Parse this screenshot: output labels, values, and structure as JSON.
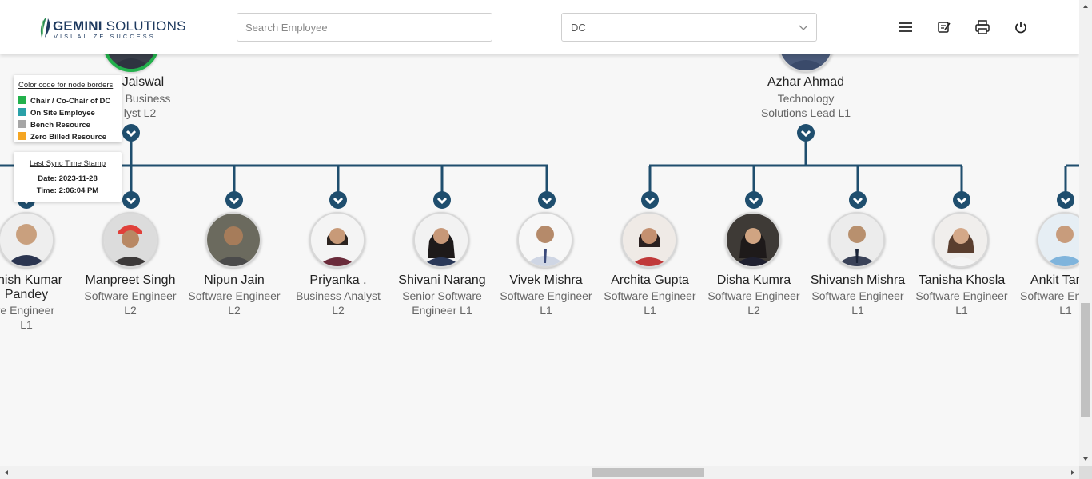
{
  "header": {
    "logo_name_bold": "GEMINI",
    "logo_name_rest": " SOLUTIONS",
    "logo_tagline": "VISUALIZE SUCCESS",
    "search_placeholder": "Search Employee",
    "dept_select_value": "DC"
  },
  "toolbar_icons": [
    "menu-icon",
    "notes-icon",
    "print-icon",
    "power-icon"
  ],
  "top_managers": [
    {
      "name": "i Jaiswal",
      "designation_line1": "Business",
      "designation_line2": "lyst L2"
    },
    {
      "name": "Azhar Ahmad",
      "designation_line1": "Technology",
      "designation_line2": "Solutions Lead L1"
    }
  ],
  "employees": [
    {
      "name_line1": "anish Kumar",
      "name_line2": "Pandey",
      "designation_line1": "ware Engineer",
      "designation_line2": "L1"
    },
    {
      "name_line1": "Manpreet Singh",
      "designation_line1": "Software Engineer",
      "designation_line2": "L2"
    },
    {
      "name_line1": "Nipun Jain",
      "designation_line1": "Software Engineer",
      "designation_line2": "L2"
    },
    {
      "name_line1": "Priyanka .",
      "designation_line1": "Business Analyst",
      "designation_line2": "L2"
    },
    {
      "name_line1": "Shivani Narang",
      "designation_line1": "Senior Software",
      "designation_line2": "Engineer L1"
    },
    {
      "name_line1": "Vivek Mishra",
      "designation_line1": "Software Engineer",
      "designation_line2": "L1"
    },
    {
      "name_line1": "Archita Gupta",
      "designation_line1": "Software Engineer",
      "designation_line2": "L1"
    },
    {
      "name_line1": "Disha Kumra",
      "designation_line1": "Software Engineer",
      "designation_line2": "L2"
    },
    {
      "name_line1": "Shivansh Mishra",
      "designation_line1": "Software Engineer",
      "designation_line2": "L1"
    },
    {
      "name_line1": "Tanisha Khosla",
      "designation_line1": "Software Engineer",
      "designation_line2": "L1"
    },
    {
      "name_line1": "Ankit Tan",
      "designation_line1": "Software En",
      "designation_line2": "L1"
    }
  ],
  "legend": {
    "title": "Color code for node borders",
    "items": [
      {
        "label": "Chair / Co-Chair of DC",
        "color": "#22b14c"
      },
      {
        "label": "On Site Employee",
        "color": "#2aa1a8"
      },
      {
        "label": "Bench Resource",
        "color": "#a6a6a6"
      },
      {
        "label": "Zero Billed Resource",
        "color": "#f5a623"
      }
    ]
  },
  "sync": {
    "title": "Last Sync Time Stamp",
    "date": "Date: 2023-11-28",
    "time": "Time: 2:06:04 PM"
  },
  "colors": {
    "connector": "#1f4e6e",
    "chair_border": "#22b14c"
  }
}
